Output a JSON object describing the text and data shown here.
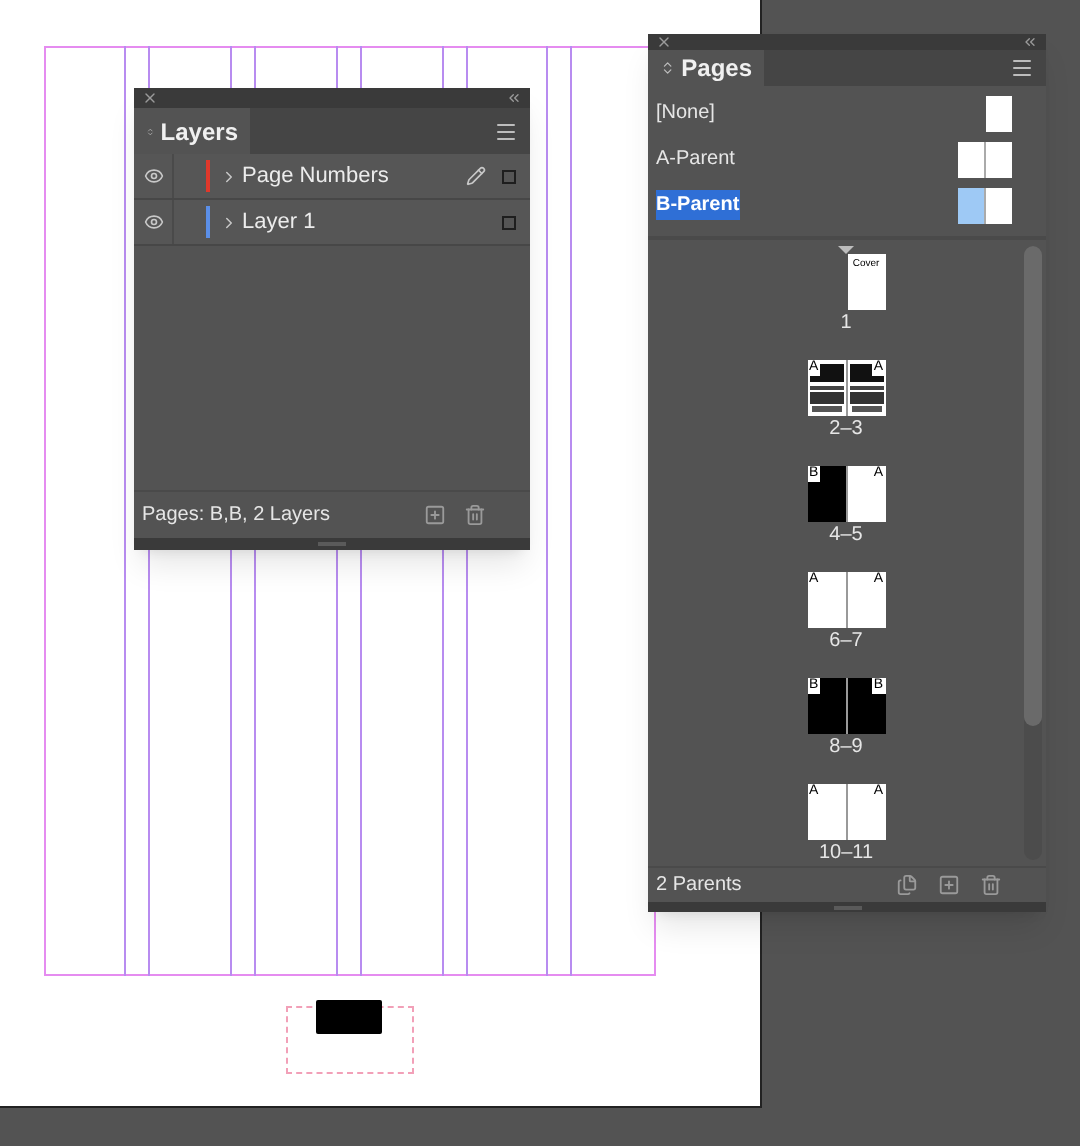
{
  "layers_panel": {
    "title": "Layers",
    "layers": [
      {
        "name": "Page Numbers",
        "color": "#e0382b",
        "visible": true,
        "target": true
      },
      {
        "name": "Layer 1",
        "color": "#5b8fe8",
        "visible": true,
        "target": false
      }
    ],
    "status": "Pages: B,B, 2 Layers"
  },
  "pages_panel": {
    "title": "Pages",
    "parents": [
      {
        "name": "[None]",
        "kind": "single",
        "selected": false
      },
      {
        "name": "A-Parent",
        "kind": "spread",
        "selected": false
      },
      {
        "name": "B-Parent",
        "kind": "spread",
        "selected": true
      }
    ],
    "pages": [
      {
        "label": "1",
        "sides": [
          {
            "caption": "Cover",
            "kind": "white"
          }
        ]
      },
      {
        "label": "2–3",
        "sides": [
          {
            "marker": "A",
            "kind": "artwork"
          },
          {
            "marker": "A",
            "kind": "artwork"
          }
        ]
      },
      {
        "label": "4–5",
        "sides": [
          {
            "marker": "B",
            "kind": "black"
          },
          {
            "marker": "A",
            "kind": "white"
          }
        ]
      },
      {
        "label": "6–7",
        "sides": [
          {
            "marker": "A",
            "kind": "white"
          },
          {
            "marker": "A",
            "kind": "white"
          }
        ]
      },
      {
        "label": "8–9",
        "sides": [
          {
            "marker": "B",
            "kind": "black"
          },
          {
            "marker": "B",
            "kind": "black"
          }
        ]
      },
      {
        "label": "10–11",
        "sides": [
          {
            "marker": "A",
            "kind": "white"
          },
          {
            "marker": "A",
            "kind": "white"
          }
        ]
      }
    ],
    "status": "2 Parents"
  }
}
